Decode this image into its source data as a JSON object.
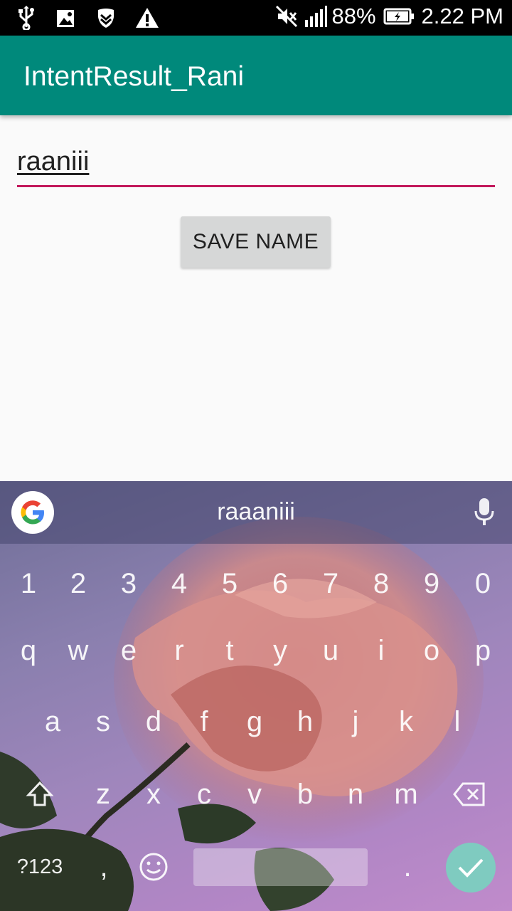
{
  "status_bar": {
    "left_icons": [
      "usb-icon",
      "image-icon",
      "shield-icon",
      "warning-icon"
    ],
    "mute_icon": "mute-icon",
    "signal_icon": "signal-icon",
    "battery": "88%",
    "battery_icon": "battery-charging-icon",
    "time": "2.22 PM"
  },
  "app_bar": {
    "title": "IntentResult_Rani",
    "color": "#00897b"
  },
  "form": {
    "name_value": "raaniii",
    "underline_color": "#c2185b",
    "save_label": "SAVE NAME"
  },
  "keyboard": {
    "suggestion": "raaaniii",
    "row_numbers": [
      "1",
      "2",
      "3",
      "4",
      "5",
      "6",
      "7",
      "8",
      "9",
      "0"
    ],
    "row_top": [
      "q",
      "w",
      "e",
      "r",
      "t",
      "y",
      "u",
      "i",
      "o",
      "p"
    ],
    "row_home": [
      "a",
      "s",
      "d",
      "f",
      "g",
      "h",
      "j",
      "k",
      "l"
    ],
    "row_bottom": [
      "z",
      "x",
      "c",
      "v",
      "b",
      "n",
      "m"
    ],
    "shift_icon": "shift-icon",
    "backspace_icon": "backspace-icon",
    "symbols_label": "?123",
    "comma_label": ",",
    "emoji_icon": "emoji-icon",
    "period_label": ".",
    "enter_icon": "checkmark-icon",
    "mic_icon": "microphone-icon",
    "logo_icon": "google-g-icon"
  }
}
